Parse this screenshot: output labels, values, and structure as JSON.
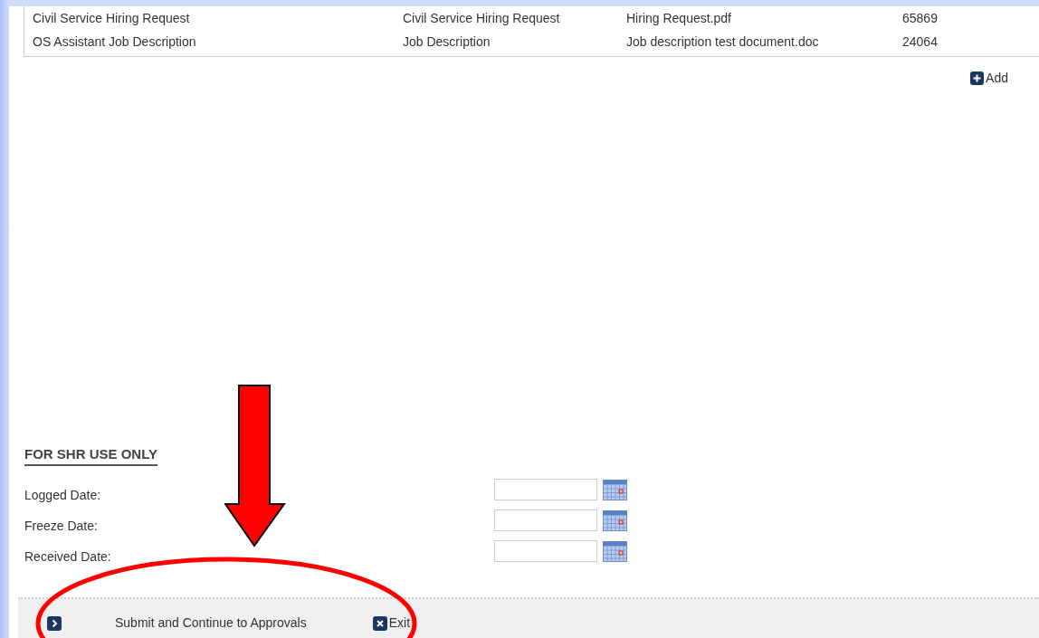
{
  "attachments": {
    "rows": [
      {
        "cells": [
          "Civil Service Hiring Request",
          "Civil Service Hiring Request",
          "Hiring Request.pdf",
          "65869"
        ]
      },
      {
        "cells": [
          "OS Assistant Job Description",
          "Job Description",
          "Job description test document.doc",
          "24064"
        ]
      }
    ],
    "add_label": "Add"
  },
  "shr_section": {
    "heading": "FOR SHR USE ONLY",
    "fields": [
      {
        "label": "Logged Date:"
      },
      {
        "label": "Freeze Date:"
      },
      {
        "label": "Received Date:"
      }
    ]
  },
  "footer": {
    "buttons": [
      {
        "kind": "next",
        "label": "Submit and Continue to Approvals"
      },
      {
        "kind": "close",
        "label": "Exit"
      }
    ]
  }
}
